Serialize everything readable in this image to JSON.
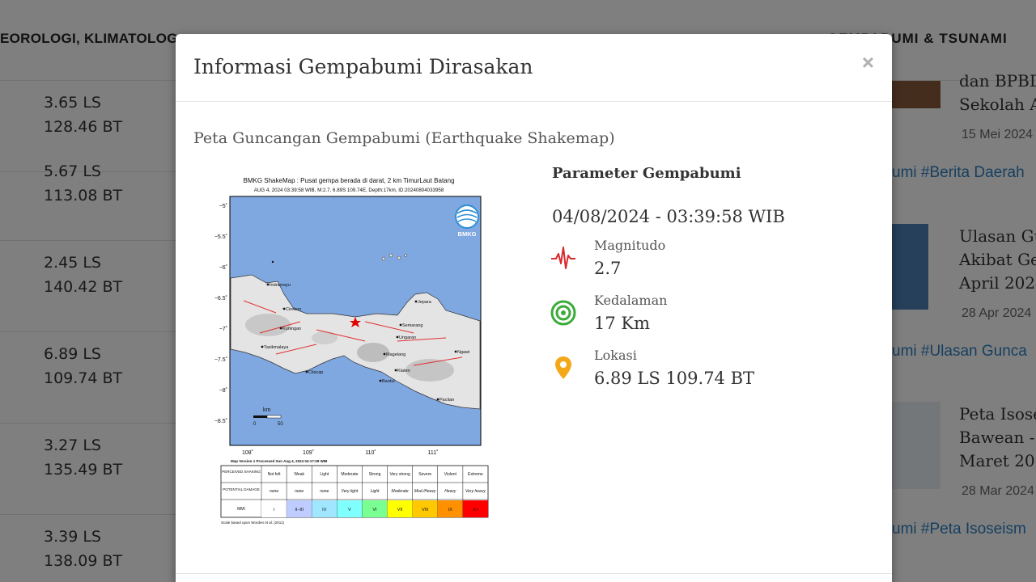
{
  "background": {
    "nav_left": "EOROLOGI, KLIMATOLOG",
    "nav_right": "GEMPABUMI & TSUNAMI",
    "rows": [
      {
        "lat": "3.65 LS",
        "lon": "128.46 BT"
      },
      {
        "lat": "5.67 LS",
        "lon": "113.08 BT"
      },
      {
        "lat": "2.45 LS",
        "lon": "140.42 BT"
      },
      {
        "lat": "6.89 LS",
        "lon": "109.74 BT"
      },
      {
        "lat": "3.27 LS",
        "lon": "135.49 BT"
      },
      {
        "lat": "3.39 LS",
        "lon": "138.09 BT"
      }
    ],
    "news": [
      {
        "title1": "dan BPBD",
        "title2": "Sekolah A",
        "date": "15 Mei 2024",
        "tag": "umi #Berita Daerah"
      },
      {
        "title1": "Ulasan Gu",
        "title2": "Akibat Ge",
        "title3": "April 2024",
        "date": "28 Apr 2024",
        "tag": "umi #Ulasan Gunca"
      },
      {
        "title1": "Peta Isose",
        "title2": "Bawean -",
        "title3": "Maret 202",
        "date": "28 Mar 2024",
        "tag": "umi #Peta Isoseism"
      }
    ]
  },
  "modal": {
    "title": "Informasi Gempabumi Dirasakan",
    "close": "×",
    "subtitle": "Peta Guncangan Gempabumi (Earthquake Shakemap)",
    "shakemap": {
      "header1": "BMKG ShakeMap : Pusat gempa berada di darat, 2 km TimurLaut Batang",
      "header2": "AUG 4, 2024 03:39:58 WIB, M:2.7, 6.89S 109.74E, Depth:17km, ID:20240804033958",
      "lat_ticks": [
        "−5˚",
        "−5.5˚",
        "−6˚",
        "−6.5˚",
        "−7˚",
        "−7.5˚",
        "−8˚",
        "−8.5˚"
      ],
      "lon_ticks": [
        "108˚",
        "109˚",
        "110˚",
        "111˚"
      ],
      "cities": [
        "Indramayu",
        "Cirebon",
        "Kuningan",
        "Tasikmalaya",
        "Cilacap",
        "Jepara",
        "Semarang",
        "Ungaran",
        "Magelang",
        "Klaten",
        "Bantul",
        "Pacitan",
        "Ngawi"
      ],
      "logo": "BMKG",
      "scale_unit": "km",
      "scale_0": "0",
      "scale_50": "50",
      "version": "Map Version 1 Processed Sun Aug 4, 2024 04:17:09 WIB",
      "legend_rows": {
        "perceived": "PERCEIVED SHAKING",
        "damage": "POTENTIAL DAMAGE",
        "mmi": "MMI"
      },
      "legend_cols": [
        {
          "shaking": "Not felt",
          "damage": "none",
          "mmi": "I",
          "color": "#ffffff"
        },
        {
          "shaking": "Weak",
          "damage": "none",
          "mmi": "II–III",
          "color": "#bfccff"
        },
        {
          "shaking": "Light",
          "damage": "none",
          "mmi": "IV",
          "color": "#a0e6ff"
        },
        {
          "shaking": "Moderate",
          "damage": "Very light",
          "mmi": "V",
          "color": "#80ffff"
        },
        {
          "shaking": "Strong",
          "damage": "Light",
          "mmi": "VI",
          "color": "#7aff93"
        },
        {
          "shaking": "Very strong",
          "damage": "Moderate",
          "mmi": "VII",
          "color": "#ffff00"
        },
        {
          "shaking": "Severe",
          "damage": "Mod./Heavy",
          "mmi": "VIII",
          "color": "#ffc800"
        },
        {
          "shaking": "Violent",
          "damage": "Heavy",
          "mmi": "IX",
          "color": "#ff9100"
        },
        {
          "shaking": "Extreme",
          "damage": "Very heavy",
          "mmi": "X+",
          "color": "#ff0000"
        }
      ],
      "footnote": "Scale based upon Worden et al. (2011)"
    },
    "params": {
      "heading": "Parameter Gempabumi",
      "datetime": "04/08/2024 - 03:39:58 WIB",
      "magnitude_label": "Magnitudo",
      "magnitude_value": "2.7",
      "depth_label": "Kedalaman",
      "depth_value": "17 Km",
      "location_label": "Lokasi",
      "location_value": "6.89 LS 109.74 BT"
    }
  },
  "colors": {
    "sea": "#7fa7e0",
    "magnitude_icon": "#d9272e",
    "depth_icon": "#3cab3a",
    "location_icon": "#f3a81a",
    "link": "#2d7fc1"
  }
}
